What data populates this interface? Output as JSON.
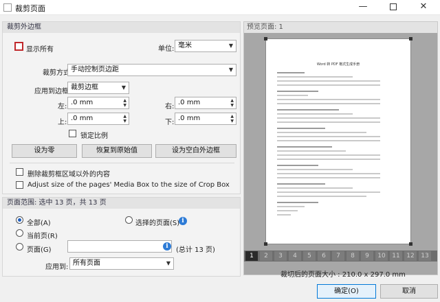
{
  "window": {
    "title": "裁剪页面",
    "minimize_glyph": "—",
    "close_glyph": "✕"
  },
  "margins_group": {
    "header": "裁剪外边框",
    "show_all_label": "显示所有",
    "unit_label": "单位:",
    "unit_value": "毫米",
    "crop_mode_label": "裁剪方式",
    "crop_mode_value": "手动控制页边距",
    "apply_to_box_label": "应用到边框",
    "apply_to_box_value": "裁剪边框",
    "left_label": "左:",
    "left_value": ".0 mm",
    "right_label": "右:",
    "right_value": ".0 mm",
    "top_label": "上:",
    "top_value": ".0 mm",
    "bottom_label": "下:",
    "bottom_value": ".0 mm",
    "lock_ratio_label": "锁定比例",
    "set_zero_label": "设为零",
    "restore_original_label": "恢复到原始值",
    "set_white_margin_label": "设为空白外边框",
    "delete_outside_label": "删除裁剪框区域以外的内容",
    "adjust_media_box_label": "Adjust size of the pages' Media Box to the size of Crop Box"
  },
  "page_range_group": {
    "header": "页面范围: 选中 13 页，共 13 页",
    "all_label": "全部(A)",
    "selected_pages_label": "选择的页面(S)",
    "current_page_label": "当前页(R)",
    "pages_label": "页面(G)",
    "pages_value": "",
    "total_label": "(总计 13 页)",
    "apply_to_label": "应用到:",
    "apply_to_value": "所有页面"
  },
  "preview": {
    "header": "预览页面: 1",
    "page_title": "Word 转 PDF 格式生成手册",
    "thumbnails": [
      "1",
      "2",
      "3",
      "4",
      "5",
      "6",
      "7",
      "8",
      "9",
      "10",
      "11",
      "12",
      "13"
    ],
    "active_page": "1",
    "size_label": "裁切后的页面大小 : 210.0 x 297.0 mm"
  },
  "footer": {
    "ok_label": "确定(O)",
    "cancel_label": "取消"
  },
  "colors": {
    "accent_blue": "#0078d7",
    "focus_red": "#c0282b",
    "info_blue": "#2d7bd6"
  }
}
